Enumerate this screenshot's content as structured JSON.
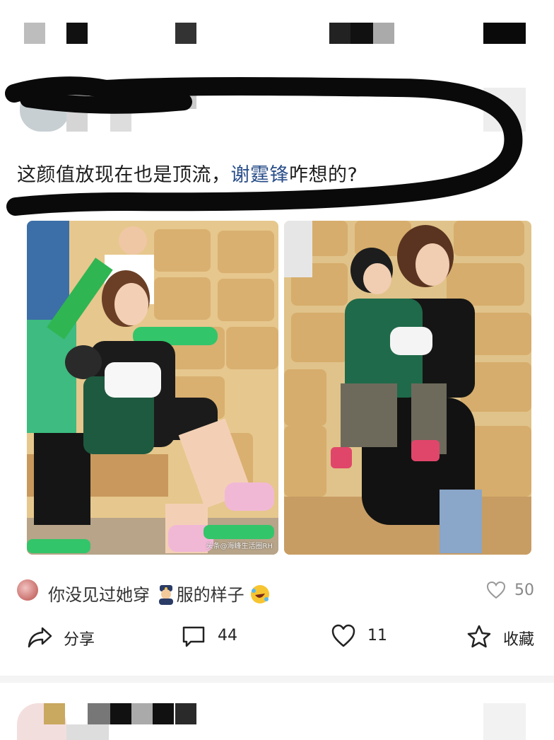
{
  "post": {
    "text_before": "这颜值放现在也是顶流，",
    "link_text": "谢霆锋",
    "text_after": "咋想的?"
  },
  "photos": {
    "watermark": "头条@海峰生活圈RH"
  },
  "comment": {
    "text_a": "你没见过她穿",
    "text_b": "服的样子",
    "police_emoji": "police-officer-emoji",
    "laugh_emoji": "rolling-laughing-emoji",
    "like_count": "50"
  },
  "actions": {
    "share_label": "分享",
    "comment_count": "44",
    "like_count": "11",
    "favorite_label": "收藏"
  },
  "colors": {
    "link": "#2a4f8a",
    "redaction": "#0a0a0a",
    "seat": "#d9b678",
    "green": "#2fa85a"
  }
}
